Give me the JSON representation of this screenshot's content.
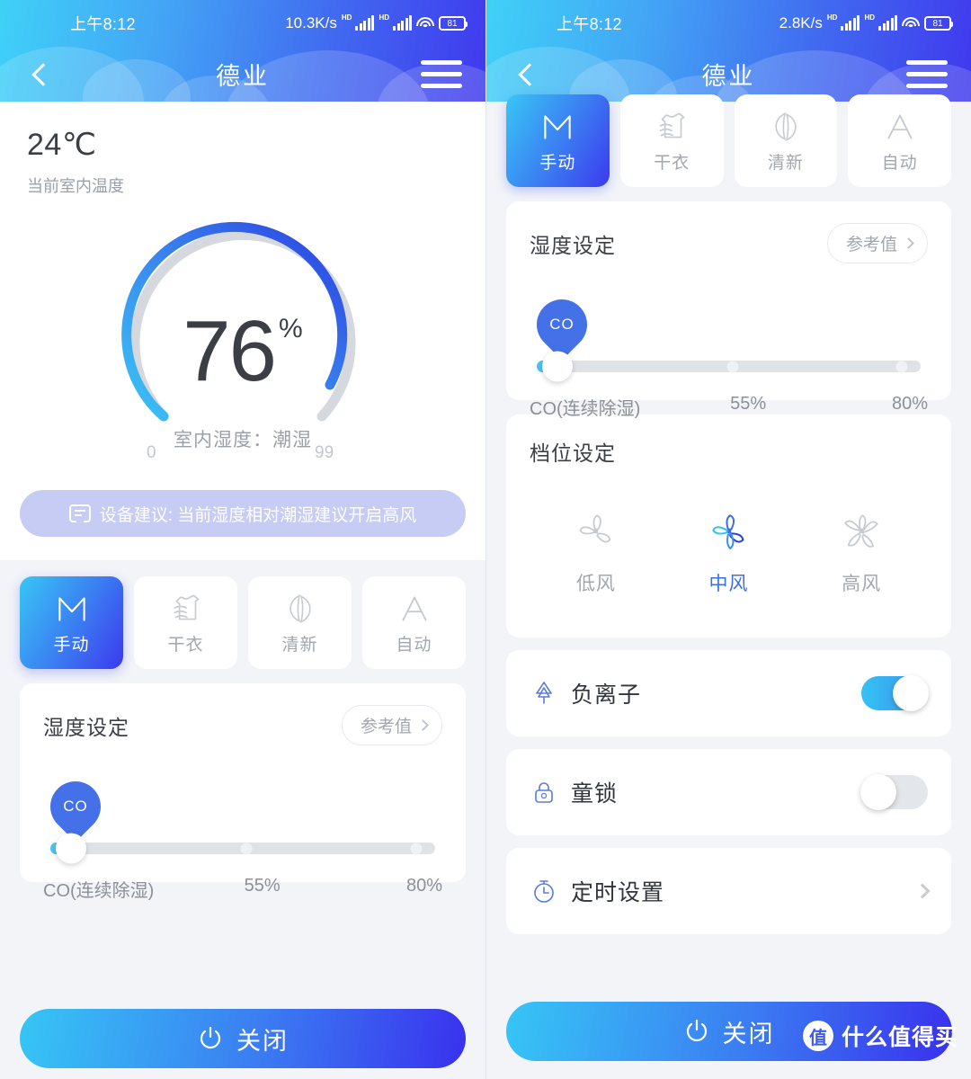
{
  "left": {
    "status": {
      "time": "上午8:12",
      "netspeed": "10.3K/s",
      "hd1": "HD",
      "hd2": "HD",
      "battery": "81"
    },
    "nav": {
      "title": "德业",
      "back_icon": "chevron-left-icon",
      "menu_icon": "hamburger-menu-icon"
    },
    "temperature": {
      "value": "24℃",
      "label": "当前室内温度"
    },
    "gauge": {
      "value": "76",
      "unit": "%",
      "description": "室内湿度：潮湿",
      "min": "0",
      "max": "99"
    },
    "tip": {
      "icon": "message-icon",
      "text": "设备建议: 当前湿度相对潮湿建议开启高风"
    },
    "modes": [
      {
        "label": "手动",
        "icon": "manual-m-icon",
        "active": true
      },
      {
        "label": "干衣",
        "icon": "dry-clothes-icon",
        "active": false
      },
      {
        "label": "清新",
        "icon": "fresh-leaf-icon",
        "active": false
      },
      {
        "label": "自动",
        "icon": "auto-a-icon",
        "active": false
      }
    ],
    "humidity": {
      "title": "湿度设定",
      "reference_label": "参考值",
      "pin_label": "CO",
      "labels": [
        "CO(连续除湿)",
        "55%",
        "80%"
      ]
    },
    "power": {
      "label": "关闭",
      "icon": "power-icon"
    }
  },
  "right": {
    "status": {
      "time": "上午8:12",
      "netspeed": "2.8K/s",
      "hd1": "HD",
      "hd2": "HD",
      "battery": "81"
    },
    "nav": {
      "title": "德业",
      "back_icon": "chevron-left-icon",
      "menu_icon": "hamburger-menu-icon"
    },
    "modes": [
      {
        "label": "手动",
        "icon": "manual-m-icon",
        "active": true
      },
      {
        "label": "干衣",
        "icon": "dry-clothes-icon",
        "active": false
      },
      {
        "label": "清新",
        "icon": "fresh-leaf-icon",
        "active": false
      },
      {
        "label": "自动",
        "icon": "auto-a-icon",
        "active": false
      }
    ],
    "humidity": {
      "title": "湿度设定",
      "reference_label": "参考值",
      "pin_label": "CO",
      "labels": [
        "CO(连续除湿)",
        "55%",
        "80%"
      ]
    },
    "fan": {
      "title": "档位设定",
      "options": [
        {
          "label": "低风",
          "icon": "fan-low-icon",
          "active": false
        },
        {
          "label": "中风",
          "icon": "fan-medium-icon",
          "active": true
        },
        {
          "label": "高风",
          "icon": "fan-high-icon",
          "active": false
        }
      ]
    },
    "rows": [
      {
        "label": "负离子",
        "icon": "anion-tree-icon",
        "type": "toggle",
        "on": true
      },
      {
        "label": "童锁",
        "icon": "child-lock-icon",
        "type": "toggle",
        "on": false
      },
      {
        "label": "定时设置",
        "icon": "timer-icon",
        "type": "link"
      }
    ],
    "power": {
      "label": "关闭",
      "icon": "power-icon"
    }
  },
  "watermark": {
    "badge": "值",
    "text": "什么值得买"
  },
  "colors": {
    "header_start": "#3FD1F7",
    "header_end": "#4039EE",
    "accent_cyan": "#34C2F3",
    "accent_blue": "#3C6FE0",
    "gauge_start": "#3BC3F5",
    "gauge_end": "#2B3FE0",
    "track": "#DFE3E8",
    "page_bg": "#F2F4F8"
  }
}
